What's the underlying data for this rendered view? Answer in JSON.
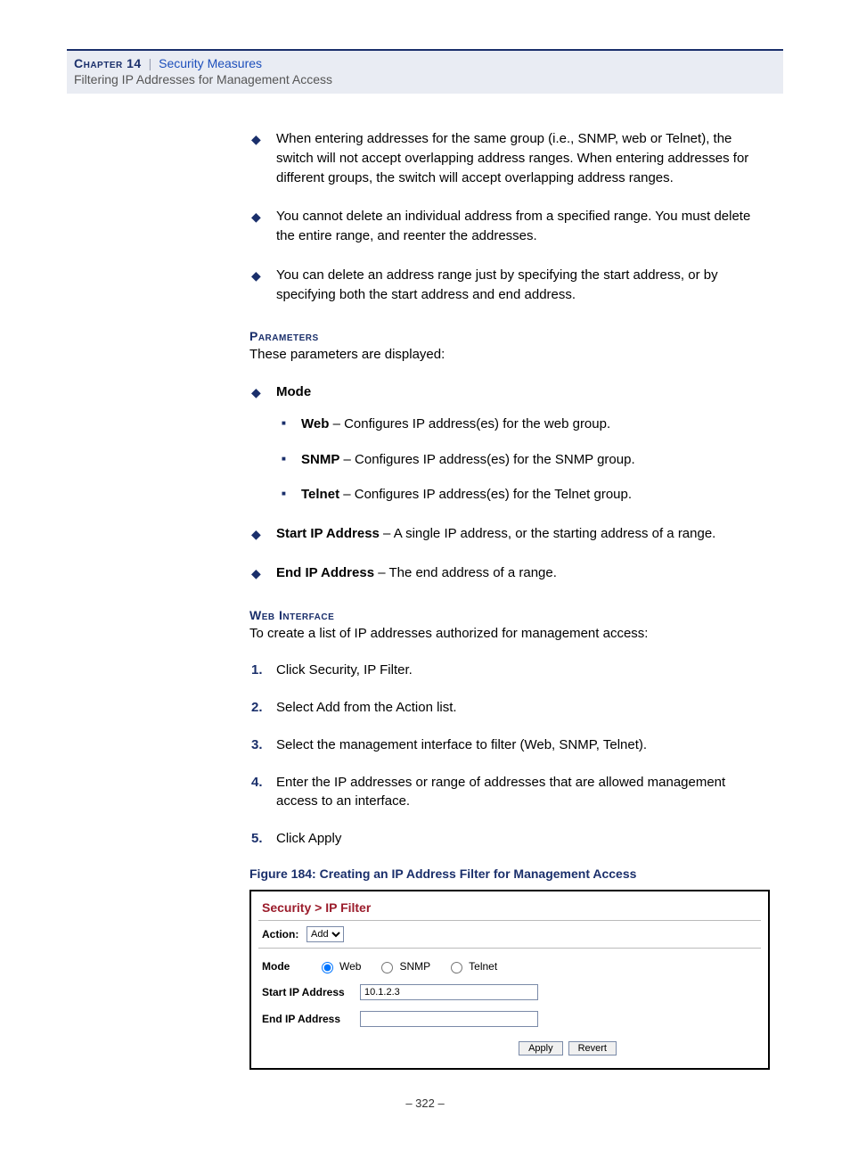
{
  "header": {
    "chapter": "Chapter 14",
    "section": "Security Measures",
    "subtitle": "Filtering IP Addresses for Management Access"
  },
  "bullets_top": [
    "When entering addresses for the same group (i.e., SNMP, web or Telnet), the switch will not accept overlapping address ranges. When entering addresses for different groups, the switch will accept overlapping address ranges.",
    "You cannot delete an individual address from a specified range. You must delete the entire range, and reenter the addresses.",
    "You can delete an address range just by specifying the start address, or by specifying both the start address and end address."
  ],
  "parameters": {
    "heading": "Parameters",
    "intro": "These parameters are displayed:",
    "items": {
      "mode": {
        "label": "Mode",
        "subitems": [
          {
            "name": "Web",
            "desc": " – Configures IP address(es) for the web group."
          },
          {
            "name": "SNMP",
            "desc": " – Configures IP address(es) for the SNMP group."
          },
          {
            "name": "Telnet",
            "desc": " – Configures IP address(es) for the Telnet group."
          }
        ]
      },
      "start_ip": {
        "label": "Start IP Address",
        "desc": " – A single IP address, or the starting address of a range."
      },
      "end_ip": {
        "label": "End IP Address",
        "desc": " – The end address of a range."
      }
    }
  },
  "web_interface": {
    "heading": "Web Interface",
    "intro": "To create a list of IP addresses authorized for management access:",
    "steps": [
      "Click Security, IP Filter.",
      "Select Add from the Action list.",
      "Select the management interface to filter (Web, SNMP, Telnet).",
      "Enter the IP addresses or range of addresses that are allowed management access to an interface.",
      "Click Apply"
    ]
  },
  "figure": {
    "caption": "Figure 184:  Creating an IP Address Filter for Management Access",
    "breadcrumb": "Security > IP Filter",
    "action_label": "Action:",
    "action_value": "Add",
    "mode_label": "Mode",
    "radios": {
      "web": "Web",
      "snmp": "SNMP",
      "telnet": "Telnet"
    },
    "start_label": "Start IP Address",
    "start_value": "10.1.2.3",
    "end_label": "End IP Address",
    "end_value": "",
    "apply": "Apply",
    "revert": "Revert"
  },
  "page_number": "–  322  –"
}
